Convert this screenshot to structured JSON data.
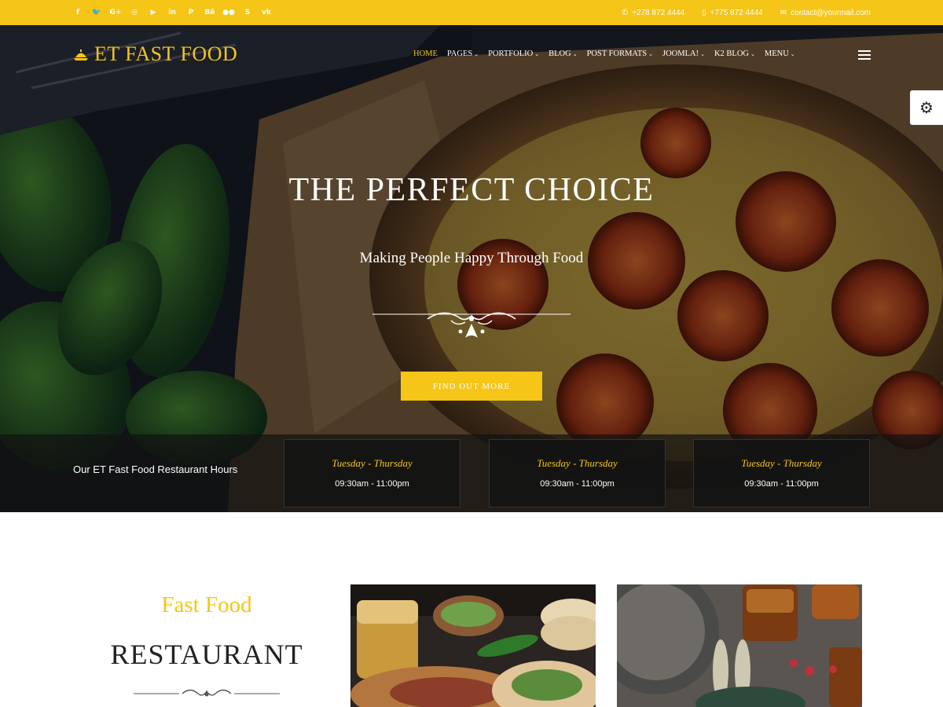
{
  "social_icons": [
    "facebook-icon",
    "twitter-icon",
    "google-plus-icon",
    "dribbble-icon",
    "youtube-icon",
    "linkedin-icon",
    "pinterest-icon",
    "behance-icon",
    "flickr-icon",
    "skype-icon",
    "vk-icon"
  ],
  "social_glyphs": [
    "f",
    "🐦",
    "G+",
    "◎",
    "▶",
    "in",
    "P",
    "Bē",
    "●●",
    "S",
    "vk"
  ],
  "contact": {
    "phone1": "+278 872 4444",
    "phone2": "+775 872 4444",
    "email": "contact@yourmail.com"
  },
  "brand": {
    "name": "ET FAST FOOD",
    "accent": "#f5c518"
  },
  "nav": [
    {
      "label": "HOME",
      "active": true,
      "has_dropdown": false
    },
    {
      "label": "PAGES",
      "active": false,
      "has_dropdown": true
    },
    {
      "label": "PORTFOLIO",
      "active": false,
      "has_dropdown": true
    },
    {
      "label": "BLOG",
      "active": false,
      "has_dropdown": true
    },
    {
      "label": "POST FORMATS",
      "active": false,
      "has_dropdown": true
    },
    {
      "label": "JOOMLA!",
      "active": false,
      "has_dropdown": true
    },
    {
      "label": "K2 BLOG",
      "active": false,
      "has_dropdown": true
    },
    {
      "label": "MENU",
      "active": false,
      "has_dropdown": true
    }
  ],
  "hero": {
    "title": "THE PERFECT CHOICE",
    "subtitle": "Making People Happy Through Food",
    "cta": "FIND OUT MORE"
  },
  "hours": {
    "label": "Our ET Fast Food Restaurant Hours",
    "cards": [
      {
        "days": "Tuesday - Thursday",
        "time": "09:30am - 11:00pm"
      },
      {
        "days": "Tuesday - Thursday",
        "time": "09:30am - 11:00pm"
      },
      {
        "days": "Tuesday - Thursday",
        "time": "09:30am - 11:00pm"
      }
    ]
  },
  "about": {
    "kicker": "Fast Food",
    "title": "RESTAURANT"
  }
}
